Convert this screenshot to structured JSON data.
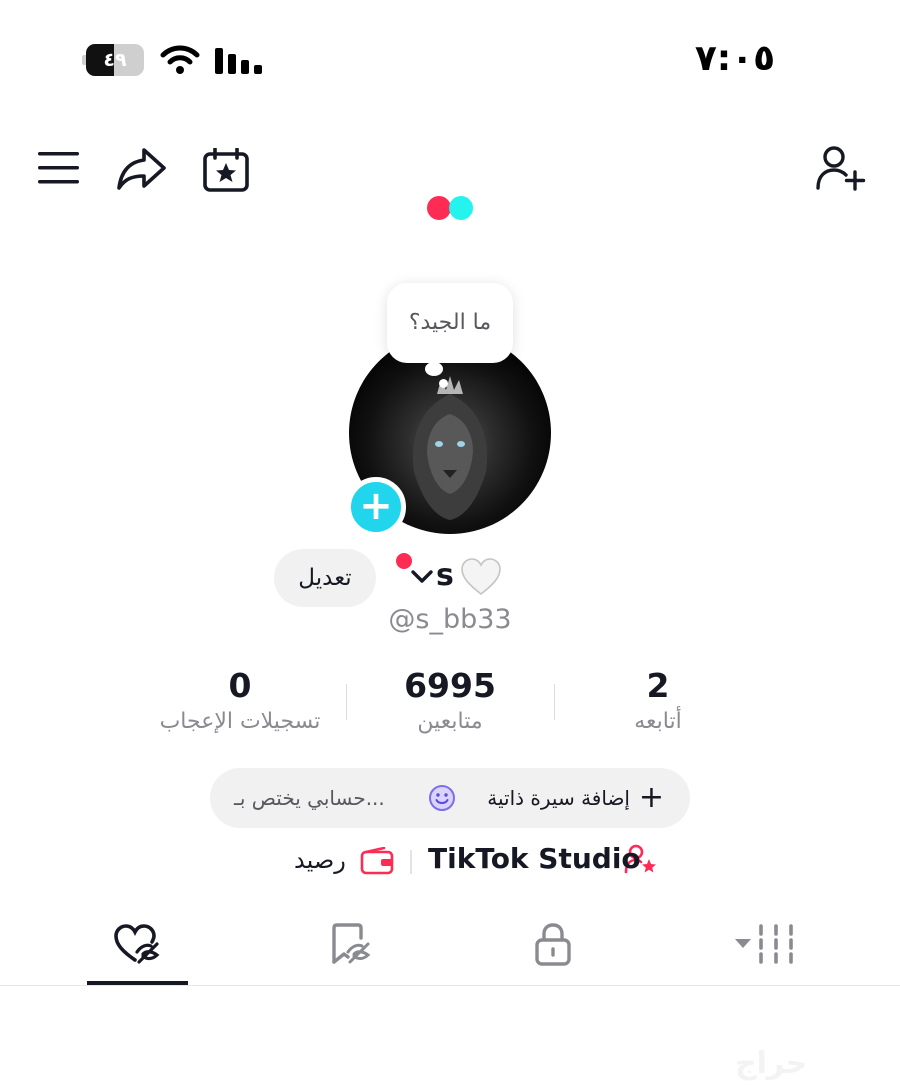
{
  "status_bar": {
    "time": "٧:٠٥",
    "battery_text": "٤٩",
    "battery_level": 0.49
  },
  "header": {
    "icons": [
      "menu-icon",
      "share-icon",
      "calendar-star-icon",
      "add-friend-icon"
    ],
    "brand_dots": {
      "red": "#fe2c55",
      "cyan": "#25f4ee"
    }
  },
  "profile": {
    "bubble_text": "ما الجيد؟",
    "name": "s",
    "username": "@s_bb33",
    "edit_label": "تعديل"
  },
  "stats": {
    "likes": {
      "value": "0",
      "label": "تسجيلات الإعجاب"
    },
    "followers": {
      "value": "6995",
      "label": "متابعين"
    },
    "following": {
      "value": "2",
      "label": "أتابعه"
    }
  },
  "bio": {
    "add_label": "إضافة سيرة ذاتية",
    "separator": "·",
    "private_label": "حسابي يختص بـ..."
  },
  "tools": {
    "studio_label": "TikTok Studio",
    "balance_label": "رصيد"
  },
  "tabs": [
    {
      "icon": "liked-videos-icon",
      "active": true
    },
    {
      "icon": "hidden-favorites-icon",
      "active": false
    },
    {
      "icon": "private-lock-icon",
      "active": false
    },
    {
      "icon": "videos-grid-icon",
      "active": false
    }
  ],
  "watermark": "حراج",
  "colors": {
    "accent": "#fe2c55",
    "cyan": "#20d5ec",
    "text": "#161823",
    "muted": "#8a8b91"
  }
}
